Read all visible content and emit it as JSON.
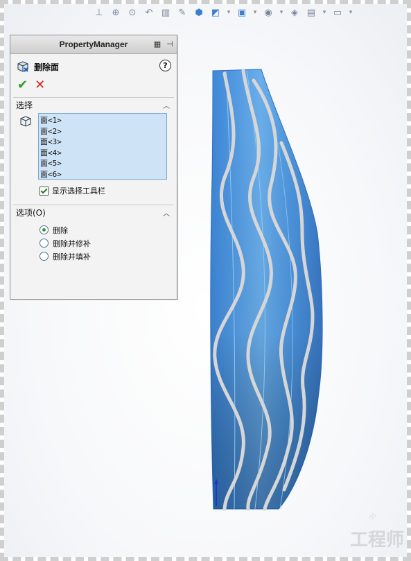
{
  "toolbar": {
    "icons": [
      "view-orientation-icon",
      "zoom-to-fit-icon",
      "zoom-area-icon",
      "previous-view-icon",
      "section-view-icon",
      "dynamic-annotation-icon",
      "view-orientation-cube-icon",
      "display-style-icon",
      "hide-show-icon",
      "edit-appearance-icon",
      "apply-scene-icon",
      "view-settings-icon"
    ]
  },
  "property_manager": {
    "title": "PropertyManager",
    "feature_name": "删除面",
    "help_label": "?",
    "ok_label": "✔",
    "cancel_label": "✕",
    "selection_section": {
      "title": "选择",
      "faces": [
        "面<1>",
        "面<2>",
        "面<3>",
        "面<4>",
        "面<5>",
        "面<6>"
      ],
      "show_toolbar_label": "显示选择工具栏",
      "show_toolbar_checked": true
    },
    "options_section": {
      "title": "选项(O)",
      "options": [
        "删除",
        "删除并修补",
        "删除并填补"
      ],
      "selected_index": 0
    }
  },
  "watermark": {
    "text": "工程师",
    "small": "小"
  },
  "colors": {
    "model_blue": "#3b82d4",
    "stripe": "#d4d4d4"
  }
}
